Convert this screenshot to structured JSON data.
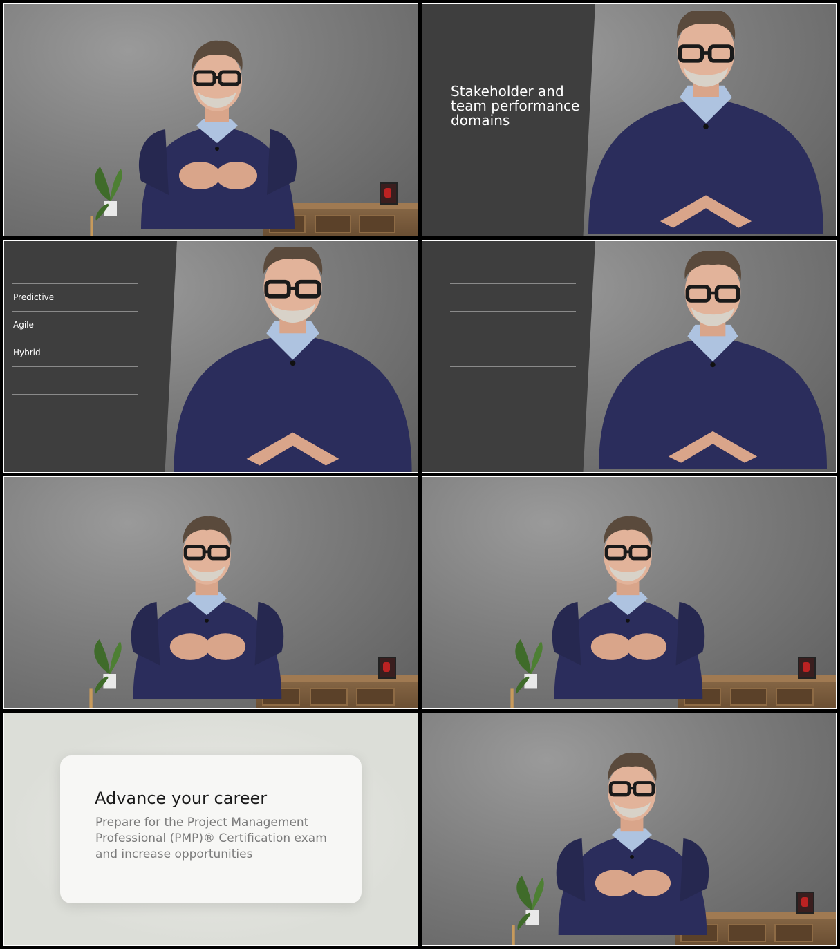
{
  "frames": [
    {
      "id": "frame-1",
      "scene": "presenter-wide"
    },
    {
      "id": "frame-2",
      "scene": "presenter-close-panel",
      "panel_title": "Stakeholder and team performance domains"
    },
    {
      "id": "frame-3",
      "scene": "presenter-close-list",
      "list_items": [
        "Predictive",
        "Agile",
        "Hybrid",
        "",
        ""
      ]
    },
    {
      "id": "frame-4",
      "scene": "presenter-close-empty-list"
    },
    {
      "id": "frame-5",
      "scene": "presenter-wide"
    },
    {
      "id": "frame-6",
      "scene": "presenter-wide"
    },
    {
      "id": "frame-7",
      "scene": "end-card",
      "card_title": "Advance your career",
      "card_subtitle": "Prepare for the Project Management Professional (PMP)® Certification exam and increase opportunities"
    },
    {
      "id": "frame-8",
      "scene": "presenter-wide"
    }
  ],
  "colors": {
    "sweater": "#2b2d5c",
    "panel": "#3e3e3e",
    "backdrop": "#7d7d7d",
    "card_bg": "#f7f7f5",
    "frame_border": "#ffffff"
  }
}
